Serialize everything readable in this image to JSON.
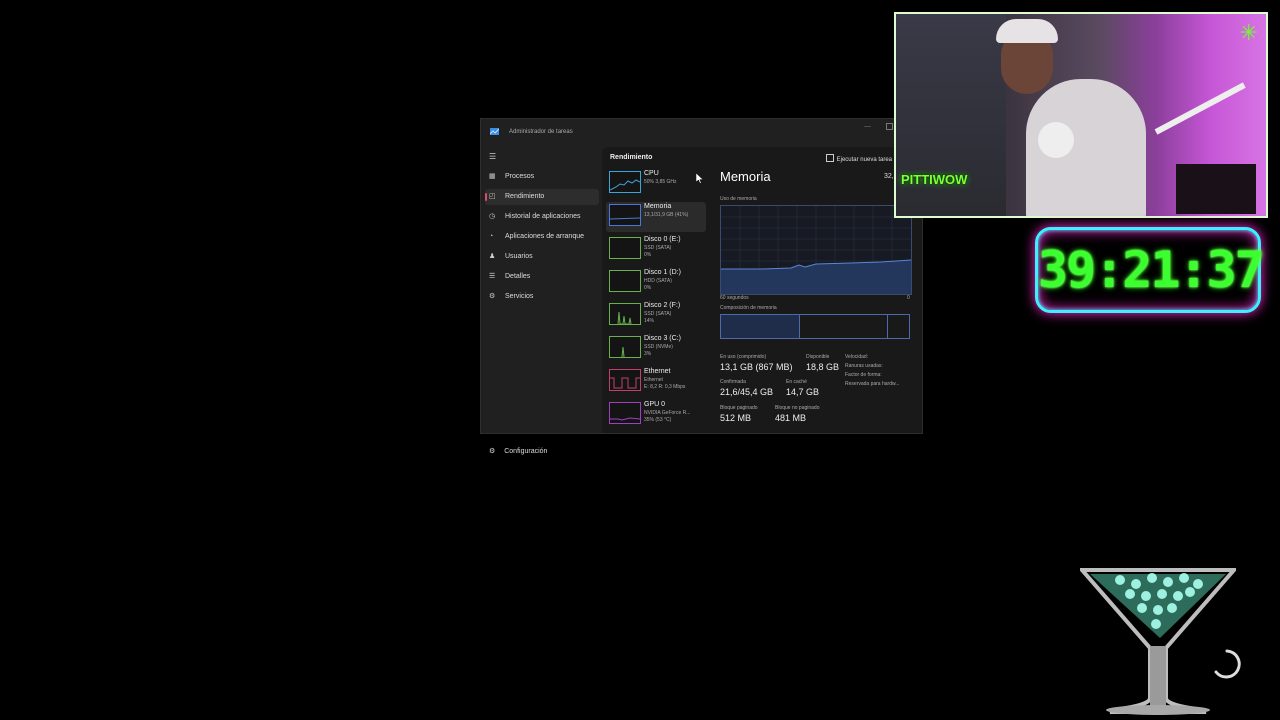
{
  "window": {
    "title": "Administrador de tareas"
  },
  "nav": {
    "items": [
      {
        "label": "Procesos",
        "icon": "processes-icon",
        "active": false
      },
      {
        "label": "Rendimiento",
        "icon": "performance-icon",
        "active": true
      },
      {
        "label": "Historial de aplicaciones",
        "icon": "history-icon",
        "active": false
      },
      {
        "label": "Aplicaciones de arranque",
        "icon": "startup-icon",
        "active": false
      },
      {
        "label": "Usuarios",
        "icon": "users-icon",
        "active": false
      },
      {
        "label": "Detalles",
        "icon": "details-icon",
        "active": false
      },
      {
        "label": "Servicios",
        "icon": "services-icon",
        "active": false
      }
    ],
    "settings_label": "Configuración"
  },
  "performance": {
    "heading": "Rendimiento",
    "run_task_label": "Ejecutar nueva tarea",
    "devices": [
      {
        "name": "CPU",
        "line1": "50% 3,85 GHz",
        "line2": "",
        "color": "#3aa6d8",
        "active": false
      },
      {
        "name": "Memoria",
        "line1": "13,1/31,9 GB (41%)",
        "line2": "",
        "color": "#4a78d8",
        "active": true
      },
      {
        "name": "Disco 0 (E:)",
        "line1": "SSD (SATA)",
        "line2": "0%",
        "color": "#6ab04c",
        "active": false
      },
      {
        "name": "Disco 1 (D:)",
        "line1": "HDD (SATA)",
        "line2": "0%",
        "color": "#6ab04c",
        "active": false
      },
      {
        "name": "Disco 2 (F:)",
        "line1": "SSD (SATA)",
        "line2": "14%",
        "color": "#6ab04c",
        "active": false
      },
      {
        "name": "Disco 3 (C:)",
        "line1": "SSD (NVMe)",
        "line2": "3%",
        "color": "#6ab04c",
        "active": false
      },
      {
        "name": "Ethernet",
        "line1": "Ethernet",
        "line2": "E: 8,2 R: 0,3 Mbps",
        "color": "#c0406a",
        "active": false
      },
      {
        "name": "GPU 0",
        "line1": "NVIDIA GeForce R...",
        "line2": "35% (53 °C)",
        "color": "#a040c0",
        "active": false
      }
    ],
    "detail": {
      "title": "Memoria",
      "total": "32,",
      "usage_label": "Uso de memoria",
      "time_left": "60 segundos",
      "time_right": "0",
      "composition_label": "Composición de memoria",
      "stats": {
        "in_use_label": "En uso (comprimido)",
        "in_use_value": "13,1 GB (867 MB)",
        "available_label": "Disponible",
        "available_value": "18,8 GB",
        "committed_label": "Confirmada",
        "committed_value": "21,6/45,4 GB",
        "cached_label": "En caché",
        "cached_value": "14,7 GB",
        "paged_label": "Bloque paginado",
        "paged_value": "512 MB",
        "nonpaged_label": "Bloque no paginado",
        "nonpaged_value": "481 MB"
      },
      "right_labels": [
        "Velocidad:",
        "Ranuras usadas:",
        "Factor de forma:",
        "Reservada para hardw..."
      ]
    }
  },
  "overlay": {
    "webcam_logo": "PITTIWOW",
    "timer": "39:21:37"
  },
  "colors": {
    "accent_nav": "#e04a6a",
    "memory_blue": "#4a6aaa",
    "timer_green": "#3bff2e",
    "timer_border": "#3ef0ff",
    "timer_glow": "#ff2bd6"
  }
}
